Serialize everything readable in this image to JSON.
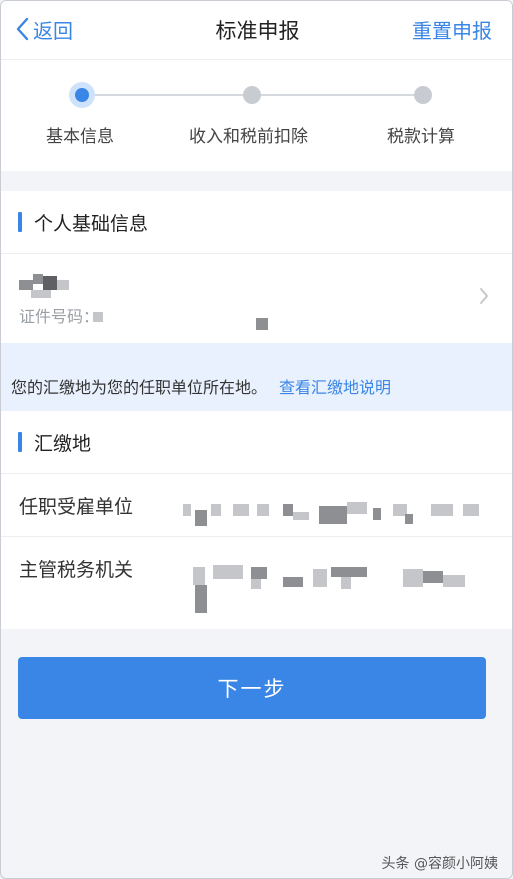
{
  "header": {
    "back_label": "返回",
    "title": "标准申报",
    "reset_label": "重置申报"
  },
  "steps": [
    {
      "label": "基本信息",
      "state": "active"
    },
    {
      "label": "收入和税前扣除",
      "state": "inactive"
    },
    {
      "label": "税款计算",
      "state": "inactive"
    }
  ],
  "personal": {
    "section_title": "个人基础信息",
    "id_label": "证件号码："
  },
  "notice": {
    "text": "您的汇缴地为您的任职单位所在地。",
    "link": "查看汇缴地说明"
  },
  "remit": {
    "section_title": "汇缴地",
    "employer_label": "任职受雇单位",
    "tax_office_label": "主管税务机关"
  },
  "next_label": "下一步",
  "watermark": "头条 @容颜小阿姨",
  "colors": {
    "accent": "#3a86e6",
    "notice_bg": "#e8f1fd",
    "page_bg": "#f2f4f8"
  }
}
